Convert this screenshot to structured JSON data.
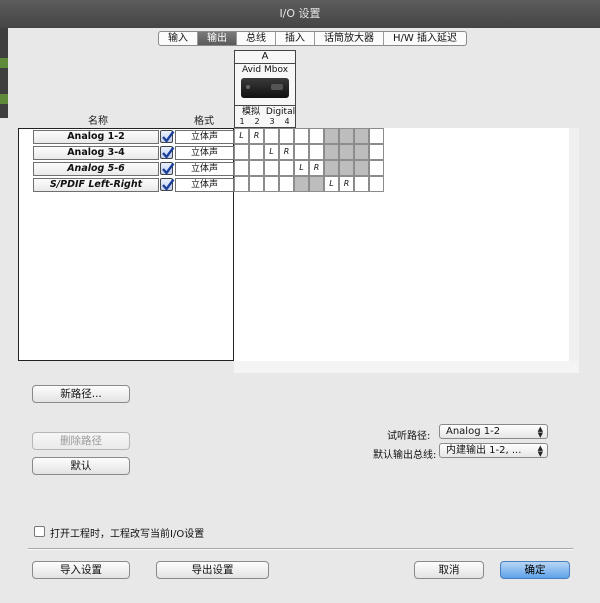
{
  "window": {
    "title": "I/O 设置"
  },
  "tabs": [
    {
      "label": "输入",
      "active": false
    },
    {
      "label": "输出",
      "active": true
    },
    {
      "label": "总线",
      "active": false
    },
    {
      "label": "插入",
      "active": false
    },
    {
      "label": "话筒放大器",
      "active": false
    },
    {
      "label": "H/W 插入延迟",
      "active": false
    }
  ],
  "columns": {
    "name": "名称",
    "format": "格式"
  },
  "device": {
    "section": "A",
    "name": "Avid Mbox",
    "icon": "audio-interface-icon",
    "groups": [
      {
        "label": "模拟"
      },
      {
        "label": "Digital"
      }
    ],
    "channels": [
      "1",
      "2",
      "3",
      "4"
    ]
  },
  "rows": [
    {
      "name": "Analog 1-2",
      "checked": true,
      "format": "立体声",
      "italic": false,
      "cells": [
        "L",
        "R",
        "",
        "",
        "",
        "",
        "",
        "",
        "",
        ""
      ]
    },
    {
      "name": "Analog 3-4",
      "checked": true,
      "format": "立体声",
      "italic": false,
      "cells": [
        "",
        "",
        "L",
        "R",
        "",
        "",
        "",
        "",
        "",
        ""
      ]
    },
    {
      "name": "Analog 5-6",
      "checked": true,
      "format": "立体声",
      "italic": true,
      "cells": [
        "",
        "",
        "",
        "",
        "L",
        "R",
        "",
        "",
        "",
        ""
      ]
    },
    {
      "name": "S/PDIF Left-Right",
      "checked": true,
      "format": "立体声",
      "italic": true,
      "cells": [
        "",
        "",
        "",
        "",
        "",
        "",
        "L",
        "R",
        "",
        ""
      ]
    }
  ],
  "buttons": {
    "new_path": "新路径...",
    "delete_path": "删除路径",
    "default": "默认",
    "import": "导入设置",
    "export": "导出设置",
    "cancel": "取消",
    "ok": "确定"
  },
  "audition": {
    "label": "试听路径:",
    "value": "Analog 1-2"
  },
  "default_bus": {
    "label": "默认输出总线:",
    "value": "内建输出 1-2, ..."
  },
  "overwrite_checkbox": {
    "label": "打开工程时，工程改写当前I/O设置",
    "checked": false
  },
  "colors": {
    "accent": "#5ea2ea",
    "active_tab": "#6a6a6a",
    "grid_gray": "#bdbdbd"
  }
}
